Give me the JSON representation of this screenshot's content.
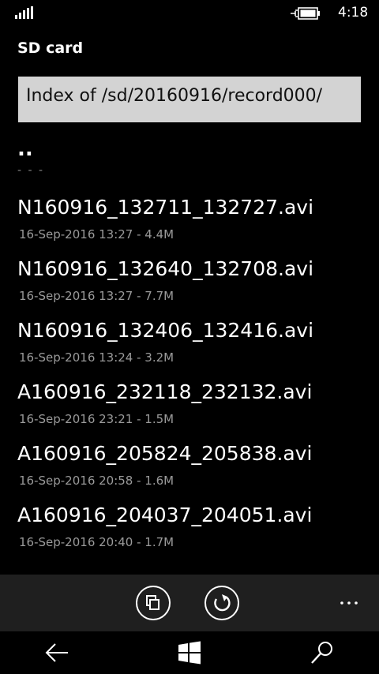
{
  "status": {
    "signal_icon": "signal-bars-icon",
    "battery_icon": "battery-charging-icon",
    "time": "4:18"
  },
  "app": {
    "title": "SD card"
  },
  "path": {
    "label": "Index of /sd/20160916/record000/"
  },
  "parent": {
    "label": "..",
    "sub": "- - -"
  },
  "files": [
    {
      "name": "N160916_132711_132727.avi",
      "meta": "16-Sep-2016 13:27 - 4.4M"
    },
    {
      "name": "N160916_132640_132708.avi",
      "meta": "16-Sep-2016 13:27 - 7.7M"
    },
    {
      "name": "N160916_132406_132416.avi",
      "meta": "16-Sep-2016 13:24 - 3.2M"
    },
    {
      "name": "A160916_232118_232132.avi",
      "meta": "16-Sep-2016 23:21 - 1.5M"
    },
    {
      "name": "A160916_205824_205838.avi",
      "meta": "16-Sep-2016 20:58 - 1.6M"
    },
    {
      "name": "A160916_204037_204051.avi",
      "meta": "16-Sep-2016 20:40 - 1.7M"
    }
  ],
  "appbar": {
    "copy_icon": "copy-icon",
    "refresh_icon": "refresh-icon",
    "more_icon": "more-icon"
  },
  "navbar": {
    "back_icon": "back-arrow-icon",
    "start_icon": "windows-logo-icon",
    "search_icon": "search-icon"
  }
}
